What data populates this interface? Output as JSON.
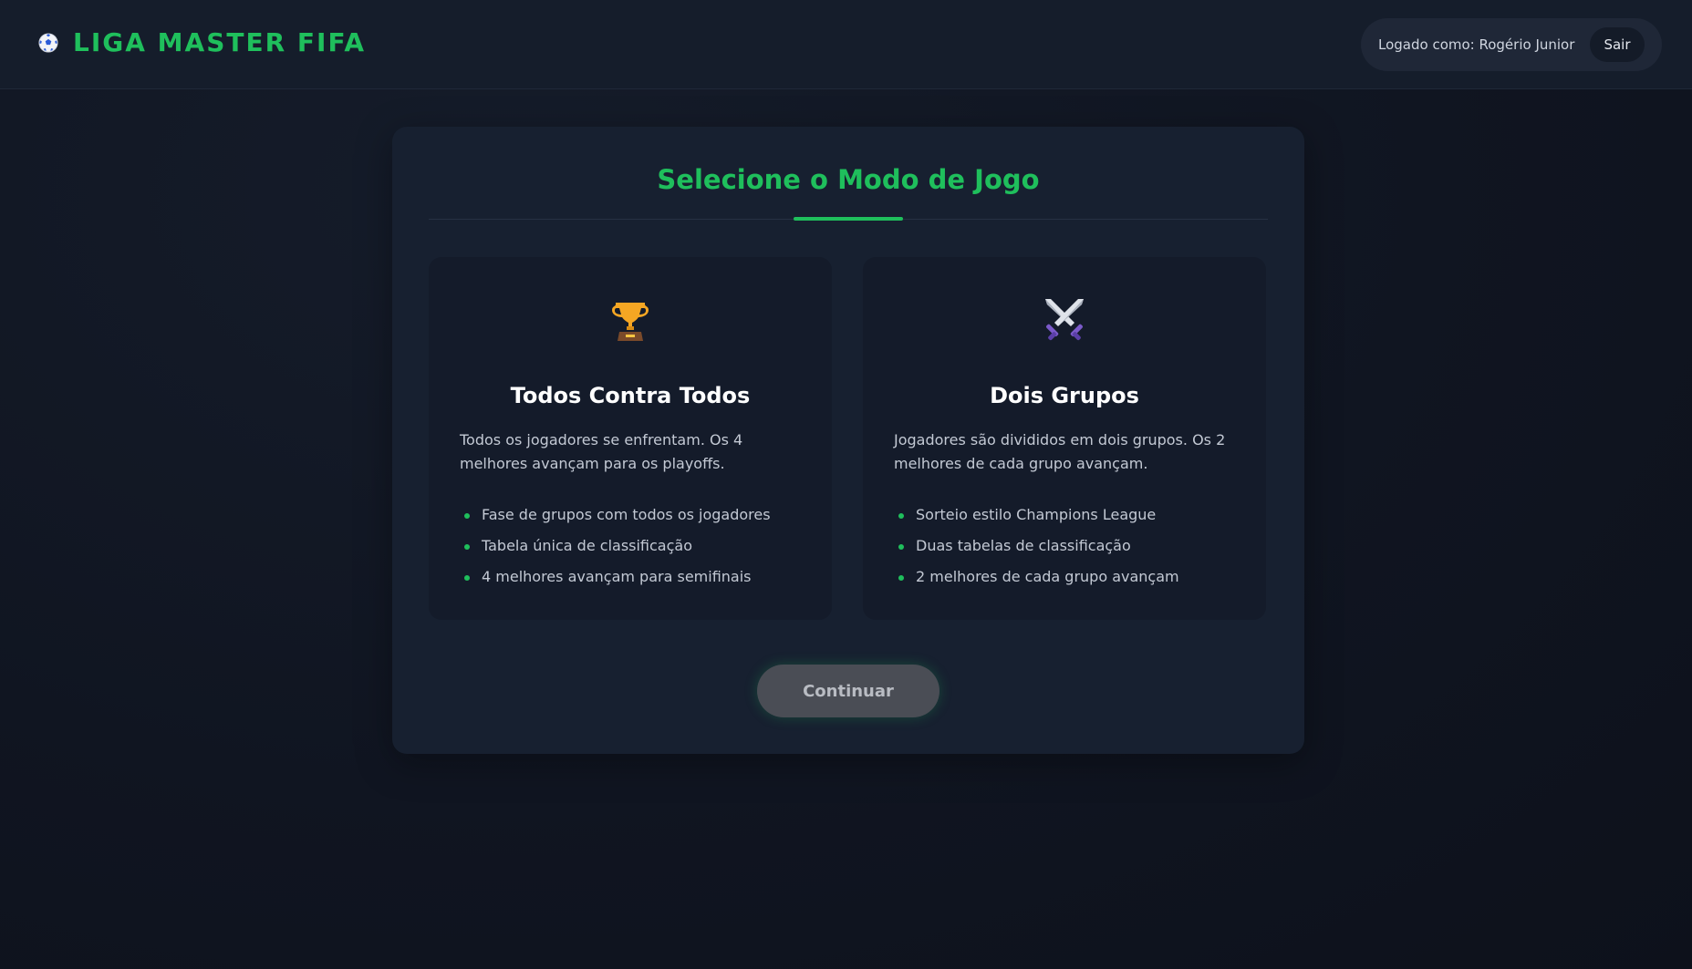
{
  "header": {
    "brand_title": "LIGA MASTER FIFA",
    "brand_icon": "soccer-ball-icon",
    "user_label": "Logado como: Rogério Junior",
    "logout_label": "Sair"
  },
  "panel": {
    "title": "Selecione o Modo de Jogo",
    "continue_label": "Continuar"
  },
  "modes": [
    {
      "icon": "trophy-icon",
      "title": "Todos Contra Todos",
      "description": "Todos os jogadores se enfrentam. Os 4 melhores avançam para os playoffs.",
      "features": [
        "Fase de grupos com todos os jogadores",
        "Tabela única de classificação",
        "4 melhores avançam para semifinais"
      ]
    },
    {
      "icon": "crossed-swords-icon",
      "title": "Dois Grupos",
      "description": "Jogadores são divididos em dois grupos. Os 2 melhores de cada grupo avançam.",
      "features": [
        "Sorteio estilo Champions League",
        "Duas tabelas de classificação",
        "2 melhores de cada grupo avançam"
      ]
    }
  ],
  "colors": {
    "accent": "#1fbf5c",
    "background": "#0f1420",
    "panel": "#172030",
    "card": "#141b2a"
  }
}
